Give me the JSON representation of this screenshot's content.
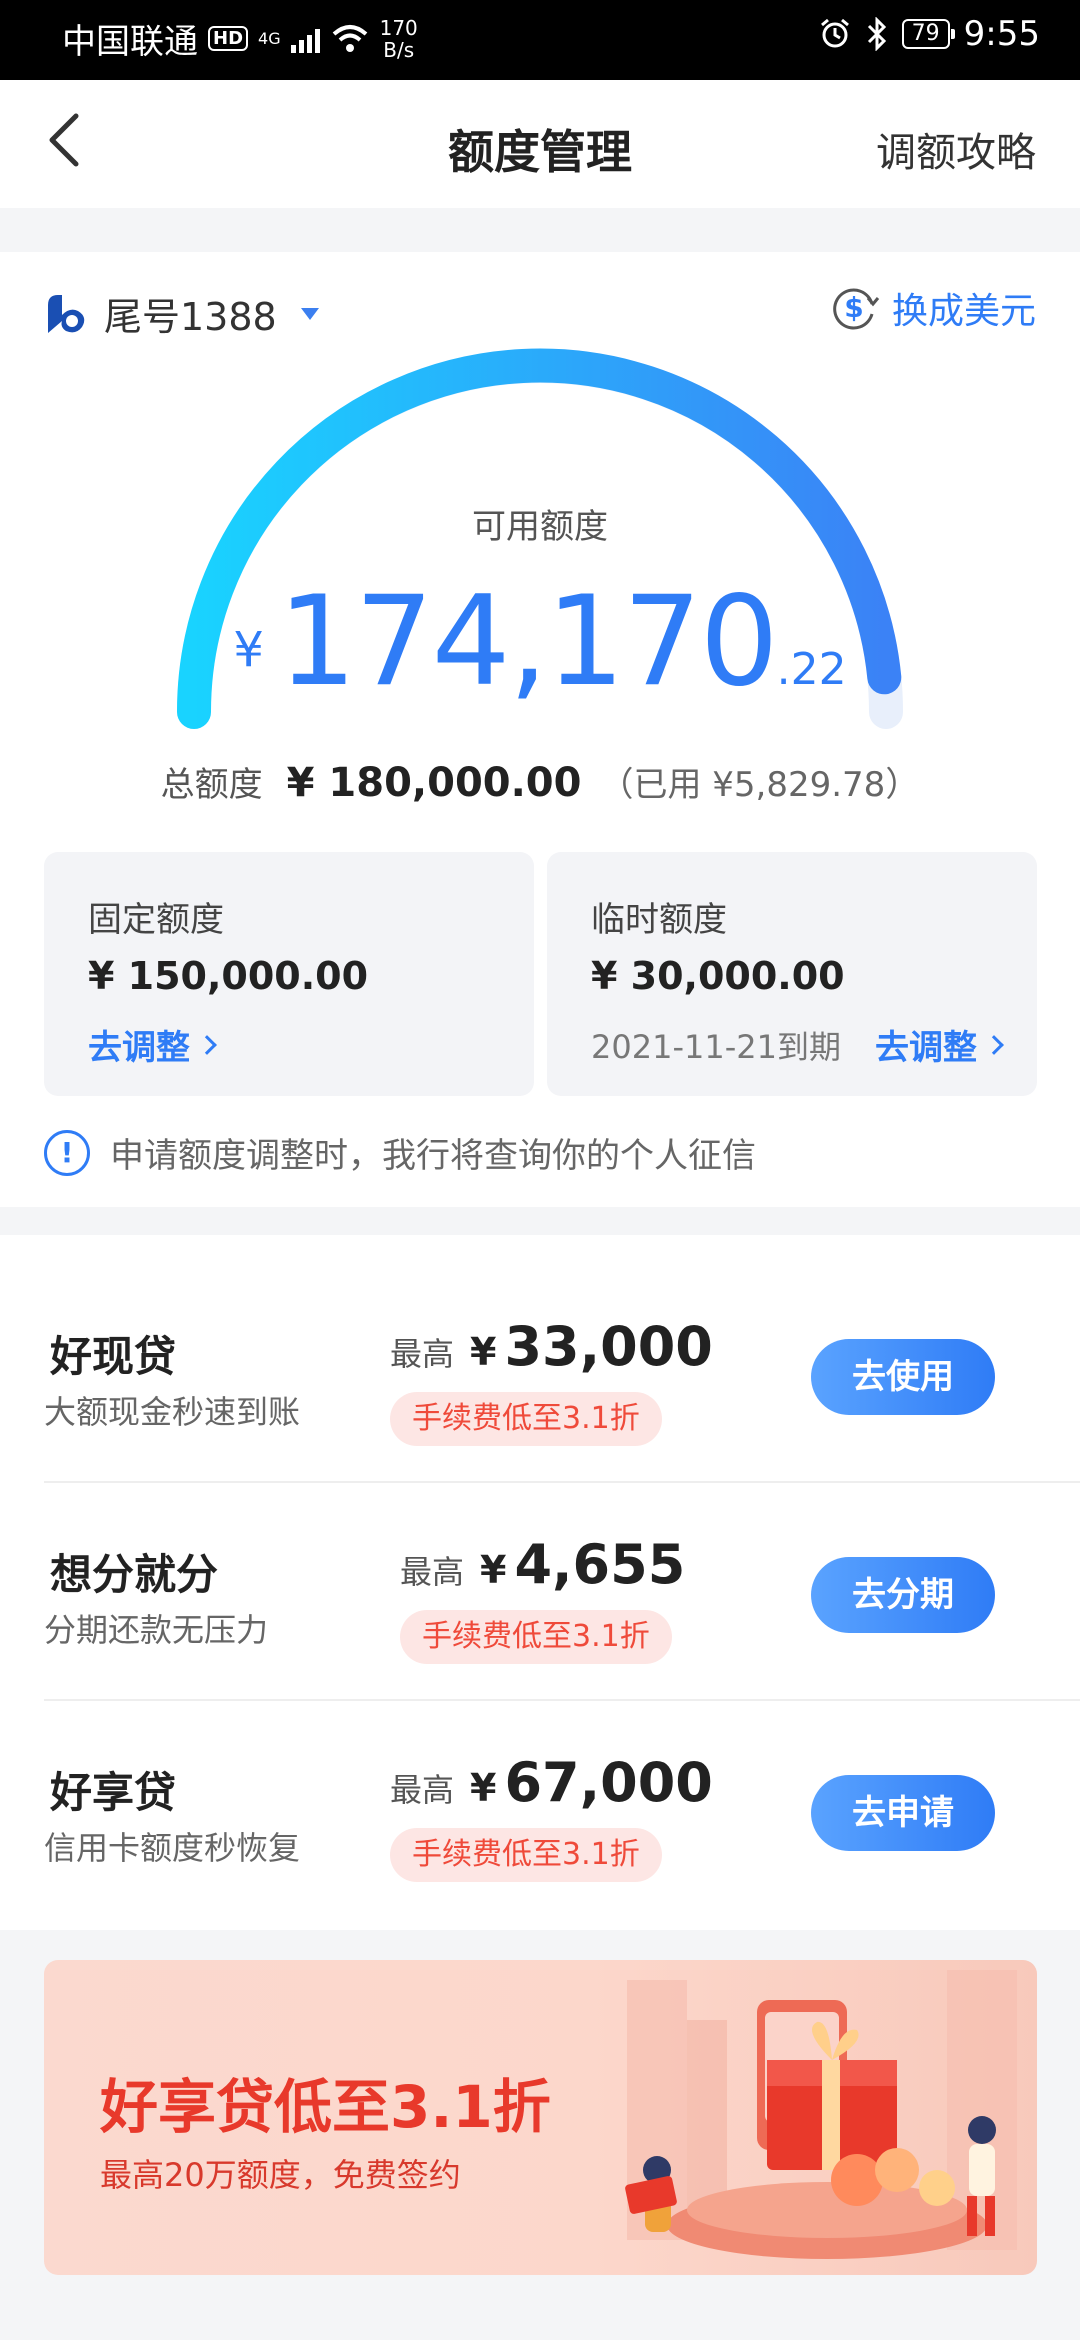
{
  "status_bar": {
    "carrier": "中国联通",
    "hd": "HD",
    "network": "4G",
    "speed_value": "170",
    "speed_unit": "B/s",
    "battery": "79",
    "time": "9:55"
  },
  "nav": {
    "title": "额度管理",
    "right_link": "调额攻略"
  },
  "account": {
    "label": "尾号1388",
    "usd_link": "换成美元"
  },
  "gauge": {
    "label": "可用额度",
    "currency": "¥",
    "amount_int": "174,170",
    "amount_dec": ".22",
    "used_fraction": 0.032
  },
  "total": {
    "label": "总额度",
    "amount": "¥ 180,000.00",
    "used": "（已用 ¥5,829.78）"
  },
  "fixed": {
    "label": "固定额度",
    "amount": "¥ 150,000.00",
    "action": "去调整"
  },
  "temporary": {
    "label": "临时额度",
    "amount": "¥ 30,000.00",
    "due": "2021-11-21到期",
    "action": "去调整"
  },
  "notice": {
    "icon": "!",
    "text": "申请额度调整时，我行将查询你的个人征信"
  },
  "products": [
    {
      "name": "好现贷",
      "desc": "大额现金秒速到账",
      "max_label": "最高",
      "currency": "¥",
      "max_value": "33,000",
      "tag": "手续费低至3.1折",
      "button": "去使用"
    },
    {
      "name": "想分就分",
      "desc": "分期还款无压力",
      "max_label": "最高",
      "currency": "¥",
      "max_value": "4,655",
      "tag": "手续费低至3.1折",
      "button": "去分期"
    },
    {
      "name": "好享贷",
      "desc": "信用卡额度秒恢复",
      "max_label": "最高",
      "currency": "¥",
      "max_value": "67,000",
      "tag": "手续费低至3.1折",
      "button": "去申请"
    }
  ],
  "banner": {
    "title": "好享贷低至3.1折",
    "subtitle": "最高20万额度，免费签约"
  },
  "colors": {
    "accent": "#2f7cf6",
    "gauge_start": "#19d3ff",
    "gauge_end": "#3b82f6",
    "promo_red": "#ef4a3a"
  }
}
